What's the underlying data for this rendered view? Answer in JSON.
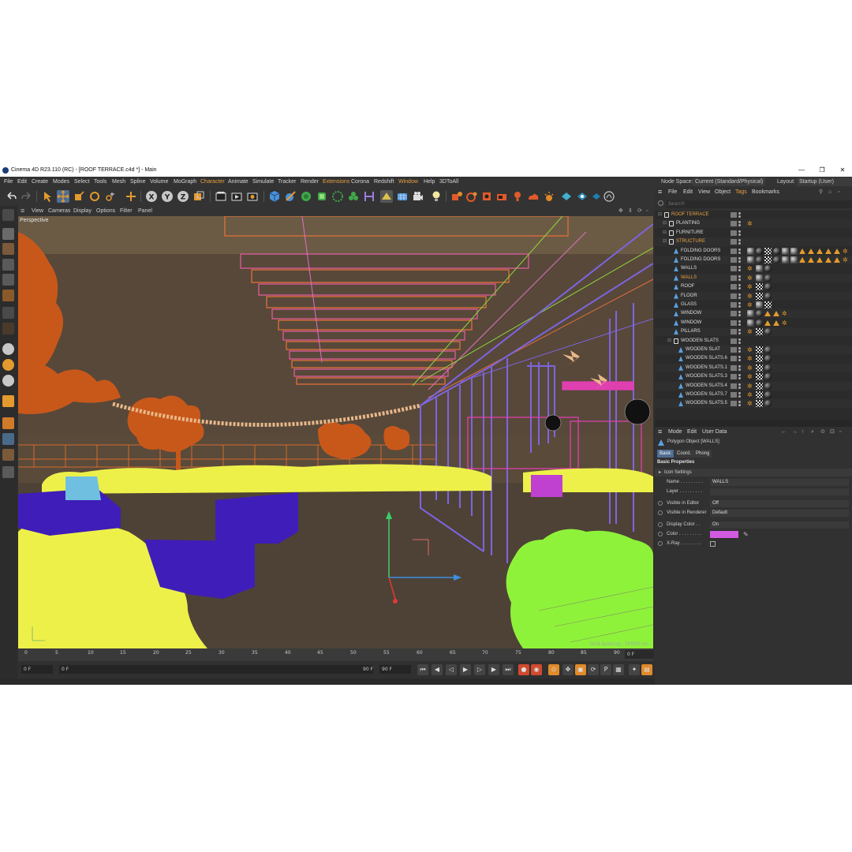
{
  "window": {
    "title": "Cinema 4D R23.110 (RC) - [ROOF TERRACE.c4d *] - Main",
    "min": "—",
    "max": "❐",
    "close": "✕"
  },
  "menu": {
    "items": [
      "File",
      "Edit",
      "Create",
      "Modes",
      "Select",
      "Tools",
      "Mesh",
      "Spline",
      "Volume",
      "MoGraph",
      "Character",
      "Animate",
      "Simulate",
      "Tracker",
      "Render",
      "Extensions",
      "Corona",
      "Redshift",
      "Window",
      "Help",
      "3DToAll"
    ],
    "node_space_label": "Node Space:",
    "node_space_value": "Current (Standard/Physical)",
    "layout_label": "Layout:",
    "layout_value": "Startup (User)"
  },
  "viewport": {
    "menu": [
      "View",
      "Cameras",
      "Display",
      "Options",
      "Filter",
      "Panel"
    ],
    "label": "Perspective",
    "grid_spacing": "Grid Spacing : 10000 cm"
  },
  "timeline": {
    "ticks": [
      "0",
      "5",
      "10",
      "15",
      "20",
      "25",
      "30",
      "35",
      "40",
      "45",
      "50",
      "55",
      "60",
      "65",
      "70",
      "75",
      "80",
      "85",
      "90"
    ],
    "current_frame": "0 F",
    "start_field": "0 F",
    "preview_start": "0 F",
    "preview_end": "90 F",
    "end_field": "90 F"
  },
  "object_manager": {
    "menu": [
      "File",
      "Edit",
      "View",
      "Object",
      "Tags",
      "Bookmarks"
    ],
    "active_menu": "Tags",
    "search_placeholder": "Search",
    "objects": [
      {
        "name": "ROOF TERRACE",
        "level": 0,
        "selected": true,
        "kind": "null",
        "tags": []
      },
      {
        "name": "PLANTING",
        "level": 1,
        "selected": false,
        "kind": "null",
        "tags": [
          "star"
        ]
      },
      {
        "name": "FURNITURE",
        "level": 1,
        "selected": false,
        "kind": "null",
        "tags": []
      },
      {
        "name": "STRUCTURE",
        "level": 1,
        "selected": true,
        "kind": "null",
        "tags": []
      },
      {
        "name": "FOLDING DOORS",
        "level": 2,
        "selected": false,
        "kind": "poly",
        "tags": [
          "ph",
          "sph",
          "chk",
          "sph",
          "ph",
          "ph",
          "tri",
          "tri",
          "tri",
          "tri",
          "tri",
          "star"
        ]
      },
      {
        "name": "FOLDING DOORS",
        "level": 2,
        "selected": false,
        "kind": "poly",
        "tags": [
          "ph",
          "sph",
          "chk",
          "sph",
          "ph",
          "ph",
          "tri",
          "tri",
          "tri",
          "tri",
          "tri",
          "star"
        ]
      },
      {
        "name": "WALLS",
        "level": 2,
        "selected": false,
        "kind": "poly",
        "tags": [
          "star",
          "ph",
          "sph"
        ]
      },
      {
        "name": "WALLS",
        "level": 2,
        "selected": true,
        "kind": "poly",
        "tags": [
          "star",
          "ph",
          "sph"
        ]
      },
      {
        "name": "ROOF",
        "level": 2,
        "selected": false,
        "kind": "poly",
        "tags": [
          "star",
          "chk",
          "sph"
        ]
      },
      {
        "name": "FLOOR",
        "level": 2,
        "selected": false,
        "kind": "poly",
        "tags": [
          "star",
          "chk",
          "sph"
        ]
      },
      {
        "name": "GLASS",
        "level": 2,
        "selected": false,
        "kind": "poly",
        "tags": [
          "star",
          "ph",
          "chk"
        ]
      },
      {
        "name": "WINDOW",
        "level": 2,
        "selected": false,
        "kind": "poly",
        "tags": [
          "ph",
          "sph",
          "tri",
          "tri",
          "star"
        ]
      },
      {
        "name": "WINDOW",
        "level": 2,
        "selected": false,
        "kind": "poly",
        "tags": [
          "ph",
          "sph",
          "tri",
          "tri",
          "star"
        ]
      },
      {
        "name": "PILLARS",
        "level": 2,
        "selected": false,
        "kind": "poly",
        "tags": [
          "star",
          "chk",
          "sph"
        ]
      },
      {
        "name": "WOODEN SLATS",
        "level": 2,
        "selected": false,
        "kind": "null",
        "tags": []
      },
      {
        "name": "WOODEN SLAT",
        "level": 3,
        "selected": false,
        "kind": "poly",
        "tags": [
          "star",
          "chk",
          "sph"
        ]
      },
      {
        "name": "WOODEN SLATS.6",
        "level": 3,
        "selected": false,
        "kind": "poly",
        "tags": [
          "star",
          "chk",
          "sph"
        ]
      },
      {
        "name": "WOODEN SLATS.1",
        "level": 3,
        "selected": false,
        "kind": "poly",
        "tags": [
          "star",
          "chk",
          "sph"
        ]
      },
      {
        "name": "WOODEN SLATS.3",
        "level": 3,
        "selected": false,
        "kind": "poly",
        "tags": [
          "star",
          "chk",
          "sph"
        ]
      },
      {
        "name": "WOODEN SLATS.4",
        "level": 3,
        "selected": false,
        "kind": "poly",
        "tags": [
          "star",
          "chk",
          "sph"
        ]
      },
      {
        "name": "WOODEN SLATS.7",
        "level": 3,
        "selected": false,
        "kind": "poly",
        "tags": [
          "star",
          "chk",
          "sph"
        ]
      },
      {
        "name": "WOODEN SLATS.5",
        "level": 3,
        "selected": false,
        "kind": "poly",
        "tags": [
          "star",
          "chk",
          "sph"
        ]
      }
    ]
  },
  "attributes": {
    "menu": [
      "Mode",
      "Edit",
      "User Data"
    ],
    "object_title": "Polygon Object [WALLS]",
    "tabs": [
      "Basic",
      "Coord.",
      "Phong"
    ],
    "active_tab": "Basic",
    "section": "Basic Properties",
    "group": "Icon Settings",
    "props": [
      {
        "label": "Name . . . . . . . . .",
        "value": "WALLS",
        "radio": false
      },
      {
        "label": "Layer . . . . . . . . .",
        "value": "",
        "radio": false
      },
      {
        "label": "Visible in Editor",
        "value": "Off",
        "radio": true
      },
      {
        "label": "Visible in Renderer",
        "value": "Default",
        "radio": true
      },
      {
        "label": "Display Color . .",
        "value": "On",
        "radio": true
      },
      {
        "label": "Color . . . . . . . . .",
        "value": "",
        "radio": true,
        "swatch": "#d15ae0"
      },
      {
        "label": "X-Ray . . . . . . . .",
        "value": "",
        "radio": true,
        "checkbox": true
      }
    ]
  },
  "colors": {
    "accent_orange": "#e8a040",
    "viewport_bg": "#57483a",
    "planting_yellow": "#eef04a",
    "planting_green": "#8ff23a",
    "structure_purple": "#7d65e0",
    "furniture_indigo": "#3f1db8",
    "wall_pink": "#e03fb0",
    "tree_orange": "#c8581a"
  }
}
